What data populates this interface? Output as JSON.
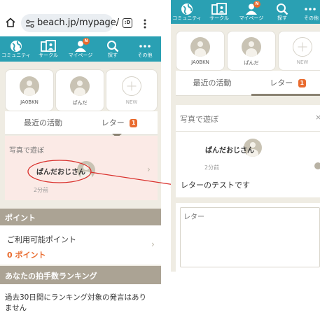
{
  "browser": {
    "url": "beach.jp/mypage/",
    "tab_count": ":D",
    "home_icon": "home-icon",
    "menu_icon": "kebab-menu-icon"
  },
  "nav": {
    "items": [
      {
        "label": "コミュニティ",
        "icon": "globe-icon"
      },
      {
        "label": "サークル",
        "icon": "circle-icon"
      },
      {
        "label": "マイページ",
        "icon": "person-icon",
        "badge": "N"
      },
      {
        "label": "探す",
        "icon": "search-icon"
      },
      {
        "label": "その他",
        "icon": "more-icon"
      }
    ]
  },
  "friends": [
    {
      "name": "JA0BKN"
    },
    {
      "name": "ぱんだ"
    },
    {
      "name": "NEW"
    }
  ],
  "tabs": {
    "recent": "最近の活動",
    "letter": "レター",
    "letter_badge": "1"
  },
  "left_letter": {
    "title": "写真で遊ぼ",
    "sender": "ぱんだおじさん",
    "time": "2分前"
  },
  "points": {
    "header": "ポイント",
    "label": "ご利用可能ポイント",
    "value": "0 ポイント"
  },
  "ranking": {
    "header": "あなたの拍手数ランキング",
    "text": "過去30日間にランキング対象の発言はありません"
  },
  "right": {
    "nav_labels": [
      "コミュニティ",
      "サークル",
      "マイページ",
      "探す",
      "その他"
    ],
    "friend_names": [
      "JA0BKN",
      "ぱんだ",
      "NEW"
    ],
    "tab_recent": "最近の活動",
    "tab_letter": "レター",
    "tab_badge": "1",
    "thread_title": "写真で遊ぼ",
    "sender": "ぱんだおじさん",
    "time": "2分前",
    "message": "レターのテストです",
    "reply_placeholder": "レター"
  },
  "colors": {
    "teal": "#2aa0b3",
    "orange": "#e96b2e",
    "beige": "#efece3",
    "pink": "#fbeae6",
    "red_annotation": "#d9302c",
    "section_header": "#aba394"
  }
}
